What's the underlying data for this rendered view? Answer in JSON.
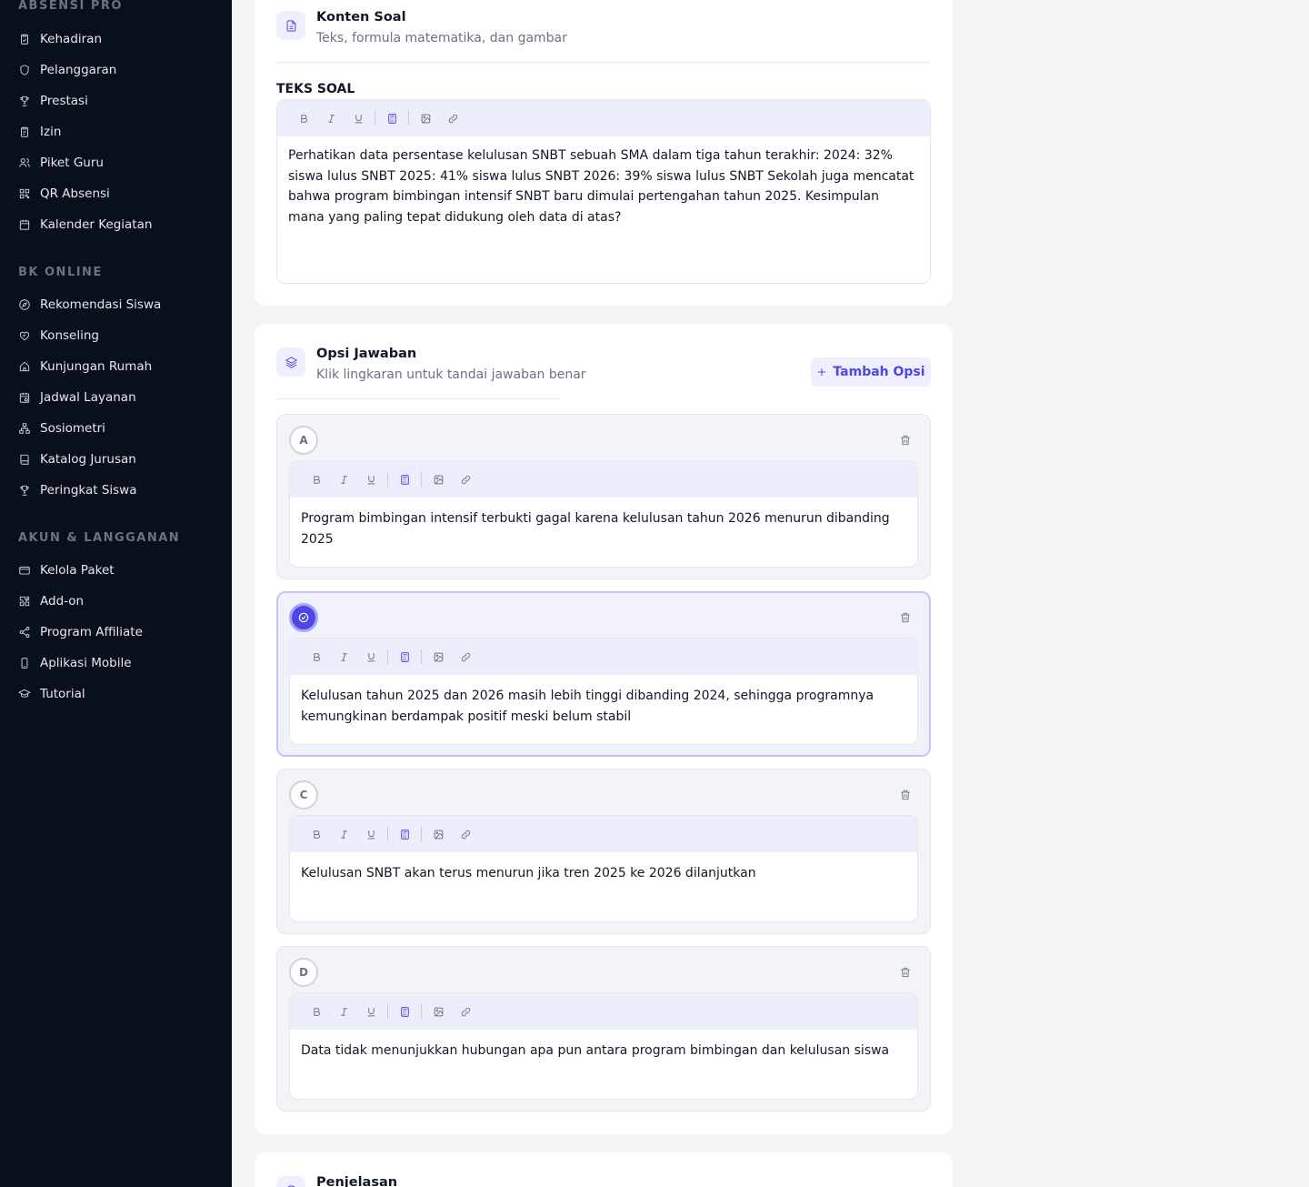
{
  "sidebar": {
    "brand": "ABSENSI PRO",
    "groups": [
      {
        "title": "",
        "items": [
          {
            "label": "Kehadiran",
            "icon": "clipboard-check-icon"
          },
          {
            "label": "Pelanggaran",
            "icon": "shield-icon"
          },
          {
            "label": "Prestasi",
            "icon": "trophy-icon"
          },
          {
            "label": "Izin",
            "icon": "clipboard-icon"
          },
          {
            "label": "Piket Guru",
            "icon": "users-icon"
          },
          {
            "label": "QR Absensi",
            "icon": "qr-code-icon"
          },
          {
            "label": "Kalender Kegiatan",
            "icon": "calendar-icon"
          }
        ]
      },
      {
        "title": "BK ONLINE",
        "items": [
          {
            "label": "Rekomendasi Siswa",
            "icon": "compass-icon"
          },
          {
            "label": "Konseling",
            "icon": "heart-handshake-icon"
          },
          {
            "label": "Kunjungan Rumah",
            "icon": "home-icon"
          },
          {
            "label": "Jadwal Layanan",
            "icon": "calendar-clock-icon"
          },
          {
            "label": "Sosiometri",
            "icon": "network-icon"
          },
          {
            "label": "Katalog Jurusan",
            "icon": "book-icon"
          },
          {
            "label": "Peringkat Siswa",
            "icon": "trophy-icon"
          }
        ]
      },
      {
        "title": "AKUN & LANGGANAN",
        "items": [
          {
            "label": "Kelola Paket",
            "icon": "credit-card-icon"
          },
          {
            "label": "Add-on",
            "icon": "puzzle-icon"
          },
          {
            "label": "Program Affiliate",
            "icon": "share-icon"
          },
          {
            "label": "Aplikasi Mobile",
            "icon": "smartphone-icon"
          },
          {
            "label": "Tutorial",
            "icon": "graduation-cap-icon"
          }
        ]
      }
    ]
  },
  "content_card": {
    "title": "Konten Soal",
    "subtitle": "Teks, formula matematika, dan gambar",
    "label": "TEKS SOAL",
    "question_text": "Perhatikan data persentase kelulusan SNBT sebuah SMA dalam tiga tahun terakhir: 2024: 32% siswa lulus SNBT 2025: 41% siswa lulus SNBT 2026: 39% siswa lulus SNBT Sekolah juga mencatat bahwa program bimbingan intensif SNBT baru dimulai pertengahan tahun 2025. Kesimpulan mana yang paling tepat didukung oleh data di atas?"
  },
  "options_card": {
    "title": "Opsi Jawaban",
    "subtitle": "Klik lingkaran untuk tandai jawaban benar",
    "add_label": "Tambah Opsi",
    "options": [
      {
        "letter": "A",
        "correct": false,
        "text": "Program bimbingan intensif terbukti gagal karena kelulusan tahun 2026 menurun dibanding 2025"
      },
      {
        "letter": "B",
        "correct": true,
        "text": "Kelulusan tahun 2025 dan 2026 masih lebih tinggi dibanding 2024, sehingga programnya kemungkinan berdampak positif meski belum stabil"
      },
      {
        "letter": "C",
        "correct": false,
        "text": "Kelulusan SNBT akan terus menurun jika tren 2025 ke 2026 dilanjutkan"
      },
      {
        "letter": "D",
        "correct": false,
        "text": "Data tidak menunjukkan hubungan apa pun antara program bimbingan dan kelulusan siswa"
      }
    ]
  },
  "explanation_card": {
    "title": "Penjelasan"
  },
  "toolbar_tools": [
    "bold-icon",
    "italic-icon",
    "underline-icon",
    "formula-icon",
    "image-icon",
    "link-icon"
  ],
  "colors": {
    "accent": "#4f46e5",
    "sidebar_bg": "#0a0f1e",
    "page_bg": "#f3f4f6"
  }
}
